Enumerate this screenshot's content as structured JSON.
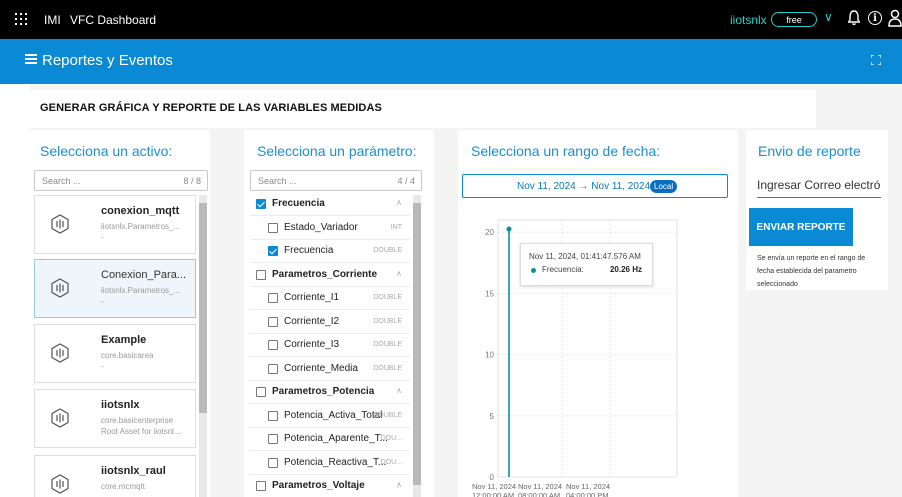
{
  "topbar": {
    "brand": "IMI",
    "app_name": "VFC Dashboard",
    "tenant": "iiotsnlx",
    "plan": "free"
  },
  "header": {
    "title": "Reportes y Eventos"
  },
  "section": {
    "title": "GENERAR GRÁFICA Y REPORTE DE LAS VARIABLES MEDIDAS"
  },
  "assets": {
    "title": "Selecciona un activo:",
    "search_placeholder": "Search ...",
    "count": "8 / 8",
    "items": [
      {
        "name": "conexion_mqtt",
        "type": "iiotsnlx.Parametros_...",
        "desc": "-"
      },
      {
        "name": "Conexion_Para...",
        "type": "iiotsnlx.Parametros_...",
        "desc": "-"
      },
      {
        "name": "Example",
        "type": "core.basicarea",
        "desc": "-"
      },
      {
        "name": "iiotsnlx",
        "type": "core.basicenterprise",
        "desc": "Root Asset for iiotsnl..."
      },
      {
        "name": "iiotsnlx_raul",
        "type": "core.mcmqtt",
        "desc": ""
      }
    ]
  },
  "parameters": {
    "title": "Selecciona un parámetro:",
    "search_placeholder": "Search ...",
    "count": "4 / 4",
    "rows": [
      {
        "label": "Frecuencia",
        "group": true,
        "checked": true,
        "type": ""
      },
      {
        "label": "Estado_Variador",
        "group": false,
        "checked": false,
        "type": "INT"
      },
      {
        "label": "Frecuencia",
        "group": false,
        "checked": true,
        "type": "DOUBLE"
      },
      {
        "label": "Parametros_Corriente",
        "group": true,
        "checked": false,
        "type": ""
      },
      {
        "label": "Corriente_I1",
        "group": false,
        "checked": false,
        "type": "DOUBLE"
      },
      {
        "label": "Corriente_I2",
        "group": false,
        "checked": false,
        "type": "DOUBLE"
      },
      {
        "label": "Corriente_I3",
        "group": false,
        "checked": false,
        "type": "DOUBLE"
      },
      {
        "label": "Corriente_Media",
        "group": false,
        "checked": false,
        "type": "DOUBLE"
      },
      {
        "label": "Parametros_Potencia",
        "group": true,
        "checked": false,
        "type": ""
      },
      {
        "label": "Potencia_Activa_Total",
        "group": false,
        "checked": false,
        "type": "DOUBLE"
      },
      {
        "label": "Potencia_Aparente_T...",
        "group": false,
        "checked": false,
        "type": "DOU..."
      },
      {
        "label": "Potencia_Reactiva_T...",
        "group": false,
        "checked": false,
        "type": "DOU..."
      },
      {
        "label": "Parametros_Voltaje",
        "group": true,
        "checked": false,
        "type": ""
      }
    ]
  },
  "daterange": {
    "title": "Selecciona un rango de fecha:",
    "range": "Nov 11, 2024 → Nov 11, 2024",
    "zone": "Local"
  },
  "chart_data": {
    "type": "line",
    "ylim": [
      0,
      21
    ],
    "yticks": [
      "20",
      "15",
      "10",
      "5",
      "0"
    ],
    "xticks": [
      {
        "date": "Nov 11, 2024",
        "time": "12:00:00 AM"
      },
      {
        "date": "Nov 11, 2024",
        "time": "08:00:00 AM"
      },
      {
        "date": "Nov 11, 2024",
        "time": "04:00:00 PM"
      }
    ],
    "series": [
      {
        "name": "Frecuencia",
        "color": "#0e8f9a",
        "x": [
          "2024-11-11 01:41:47",
          "2024-11-11 01:41:47"
        ],
        "values": [
          20.26,
          0
        ]
      }
    ],
    "tooltip": {
      "time": "Nov 11, 2024, 01:41:47.576 AM",
      "series": "Frecuencia:",
      "value": "20.26 Hz"
    }
  },
  "report": {
    "title": "Envio de reporte",
    "email_placeholder": "Ingresar Correo electrónico",
    "button": "ENVIAR REPORTE",
    "note": "Se envía un reporte en el rango de fecha establecida del parametro seleccionado"
  },
  "colors": {
    "accent": "#0a8ad4",
    "teal": "#1fd1d1",
    "series": "#0e8f9a"
  }
}
